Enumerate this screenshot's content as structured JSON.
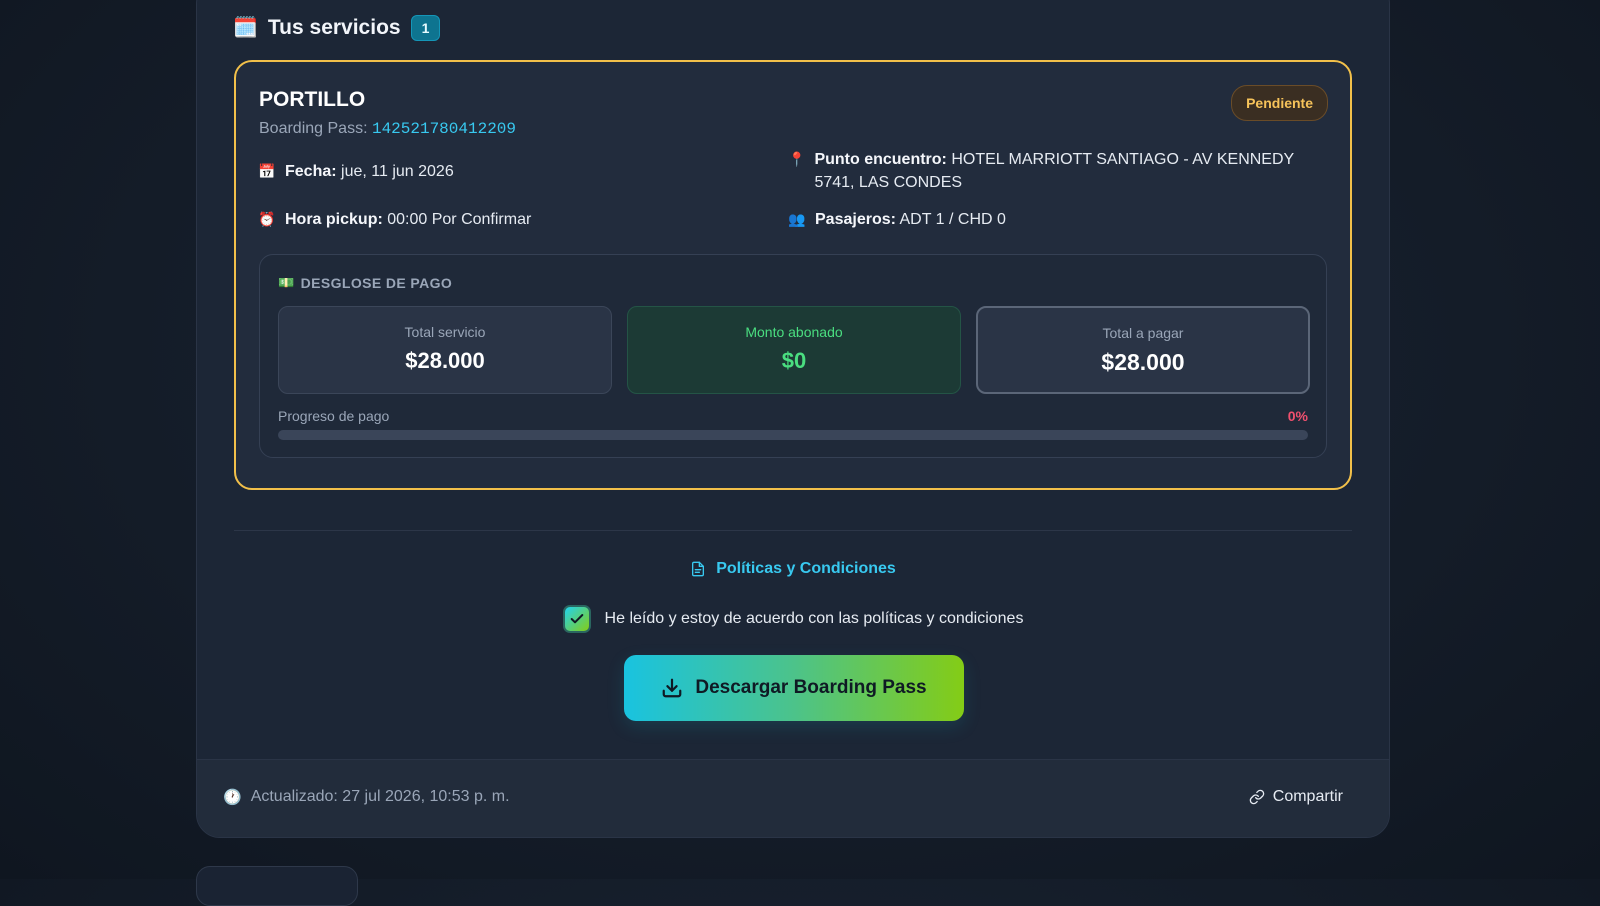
{
  "section": {
    "icon": "spiral-calendar-icon",
    "title": "Tus servicios",
    "count": "1"
  },
  "service": {
    "name": "PORTILLO",
    "boarding_pass_label": "Boarding Pass:",
    "boarding_pass_code": "142521780412209",
    "status": "Pendiente",
    "fecha_label": "Fecha:",
    "fecha_value": "jue, 11 jun 2026",
    "hora_label": "Hora pickup:",
    "hora_value": "00:00 Por Confirmar",
    "punto_label": "Punto encuentro:",
    "punto_value": "HOTEL MARRIOTT SANTIAGO - AV KENNEDY 5741, LAS CONDES",
    "pasajeros_label": "Pasajeros:",
    "pasajeros_value": "ADT 1 / CHD 0"
  },
  "payment": {
    "header": "DESGLOSE DE PAGO",
    "total_servicio_label": "Total servicio",
    "total_servicio_value": "$28.000",
    "monto_abonado_label": "Monto abonado",
    "monto_abonado_value": "$0",
    "total_pagar_label": "Total a pagar",
    "total_pagar_value": "$28.000",
    "progress_label": "Progreso de pago",
    "progress_percent_text": "0%",
    "progress_fraction": 0
  },
  "policies": {
    "link_label": "Políticas y Condiciones",
    "agree_text": "He leído y estoy de acuerdo con las políticas y condiciones",
    "agree_checked": true
  },
  "actions": {
    "download_label": "Descargar Boarding Pass"
  },
  "footer": {
    "updated_text": "Actualizado: 27 jul 2026, 10:53 p. m.",
    "share_label": "Compartir"
  },
  "colors": {
    "accent_cyan": "#38c9f0",
    "pending_border": "#f2c04a",
    "pending_text": "#f6c35a",
    "paid_green": "#4ade80",
    "progress_red": "#f0506e"
  }
}
